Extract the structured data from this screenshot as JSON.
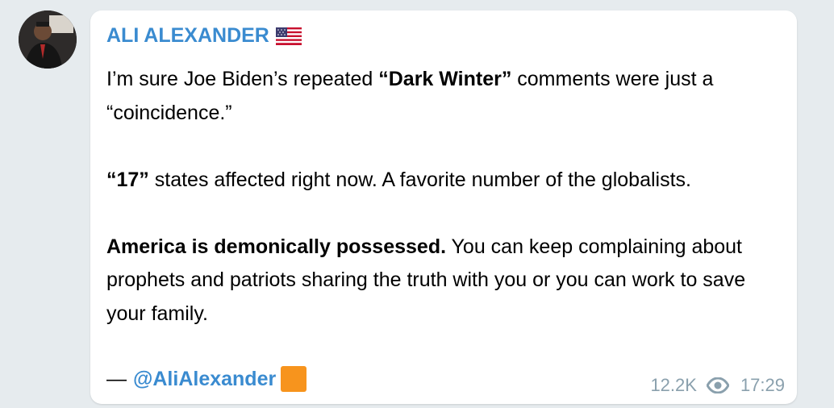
{
  "post": {
    "sender_name": "ALI ALEXANDER",
    "flag_emoji": "us-flag-icon",
    "message": {
      "line1_prefix": "I’m sure Joe Biden’s repeated ",
      "line1_bold": "“Dark Winter”",
      "line1_suffix": " comments were just a “coincidence.”",
      "para2_bold": "“17”",
      "para2_rest": " states affected right now. A favorite number of the globalists.",
      "para3_bold": "America is demonically possessed.",
      "para3_rest": " You can keep complaining about prophets and patriots sharing the truth with you or you can work to save your family."
    },
    "signature": {
      "dash": "—",
      "handle": "@AliAlexander",
      "emoji": "orange-square-icon"
    },
    "views": "12.2K",
    "time": "17:29"
  },
  "colors": {
    "background": "#e6ebee",
    "bubble": "#ffffff",
    "accent": "#3a8bd0",
    "meta": "#8aa0ad",
    "orange_square": "#f7941d"
  }
}
